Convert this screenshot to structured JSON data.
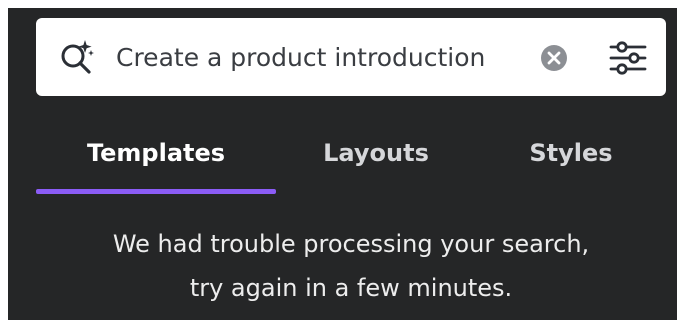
{
  "search": {
    "value": "Create a product introduction",
    "placeholder": "",
    "icon": "magic-search-icon",
    "clear_icon": "clear-icon",
    "filter_icon": "sliders-icon"
  },
  "tabs": [
    {
      "label": "Templates",
      "active": true
    },
    {
      "label": "Layouts",
      "active": false
    },
    {
      "label": "Styles",
      "active": false
    }
  ],
  "message": {
    "line1": "We had trouble processing your search,",
    "line2": "try again in a few minutes."
  },
  "colors": {
    "panel_background": "#252627",
    "active_tab_indicator": "#8b5cf6",
    "search_background": "#ffffff"
  }
}
